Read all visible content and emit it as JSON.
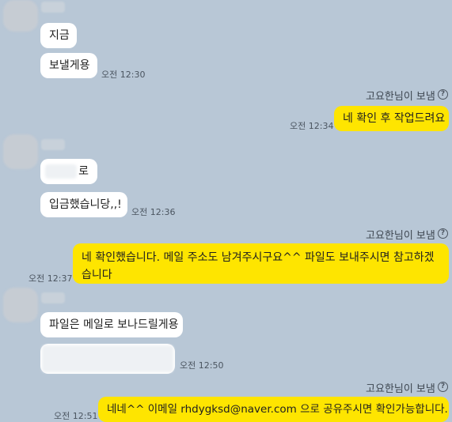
{
  "chat": {
    "sender_label": "고요한님이 보냄",
    "help_glyph": "?",
    "messages": [
      {
        "text": "지금",
        "time": ""
      },
      {
        "text": "보낼게용",
        "time": "오전 12:30"
      },
      {
        "text": "네 확인 후 작업드려요",
        "time": "오전 12:34"
      },
      {
        "text": "로",
        "time": ""
      },
      {
        "text": "입금했습니당,,!",
        "time": "오전 12:36"
      },
      {
        "text": "네 확인했습니다. 메일 주소도 남겨주시구요^^ 파일도 보내주시면 참고하겠습니다",
        "time": "오전 12:37"
      },
      {
        "text": "파일은 메일로 보나드릴게용",
        "time": ""
      },
      {
        "text": "",
        "time": "오전 12:50"
      },
      {
        "text": "네네^^ 이메일 rhdygksd@naver.com 으로 공유주시면 확인가능합니다.",
        "time": "오전 12:51"
      }
    ]
  },
  "colors": {
    "background": "#b8c7d6",
    "sent_bubble": "#fee500",
    "received_bubble": "#ffffff"
  }
}
